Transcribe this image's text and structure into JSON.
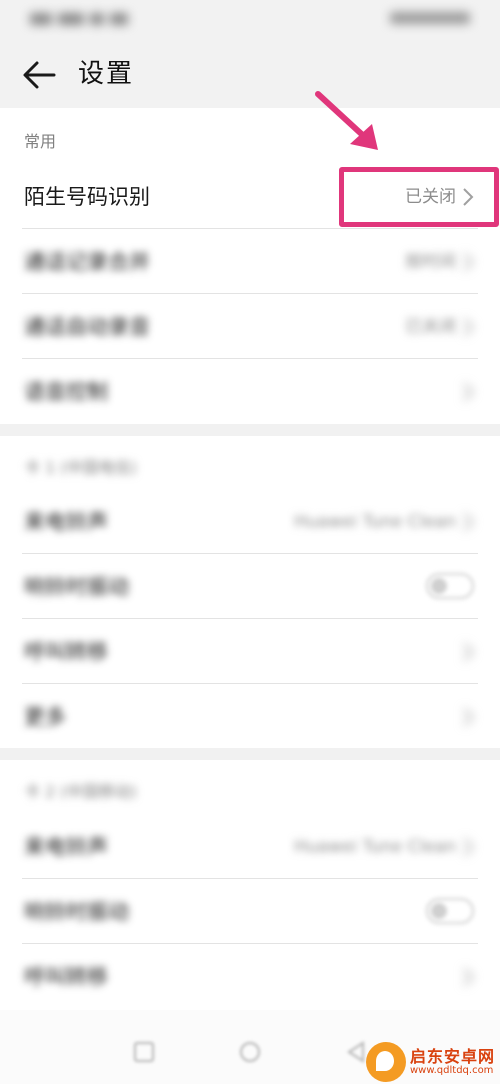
{
  "status_bar": {
    "left": "",
    "right": ""
  },
  "header": {
    "title": "设置"
  },
  "section_common": {
    "label": "常用",
    "items": [
      {
        "label": "陌生号码识别",
        "value": "已关闭"
      },
      {
        "label": "通话记录合并",
        "value": "按时间"
      },
      {
        "label": "通话自动录音",
        "value": "已关闭"
      },
      {
        "label": "语音控制",
        "value": ""
      }
    ]
  },
  "section_sim1": {
    "label": "卡 1 (中国电信)",
    "items": [
      {
        "label": "来电铃声",
        "value": "Huawei Tune Clean"
      },
      {
        "label": "响铃时振动",
        "value": ""
      },
      {
        "label": "呼叫转移",
        "value": ""
      },
      {
        "label": "更多",
        "value": ""
      }
    ]
  },
  "section_sim2": {
    "label": "卡 2 (中国移动)",
    "items": [
      {
        "label": "来电铃声",
        "value": "Huawei Tune Clean"
      },
      {
        "label": "响铃时振动",
        "value": ""
      },
      {
        "label": "呼叫转移",
        "value": ""
      }
    ]
  },
  "toggles": {
    "sim1_vibrate": false,
    "sim2_vibrate": false
  },
  "annotation": {
    "color": "#e0367b"
  },
  "watermark": {
    "title": "启东安卓网",
    "url": "www.qdltdq.com"
  },
  "colors": {
    "background": "#ffffff",
    "appbar": "#f2f2f2",
    "secondary_text": "#8c8c8c",
    "watermark": "#d9420f"
  }
}
